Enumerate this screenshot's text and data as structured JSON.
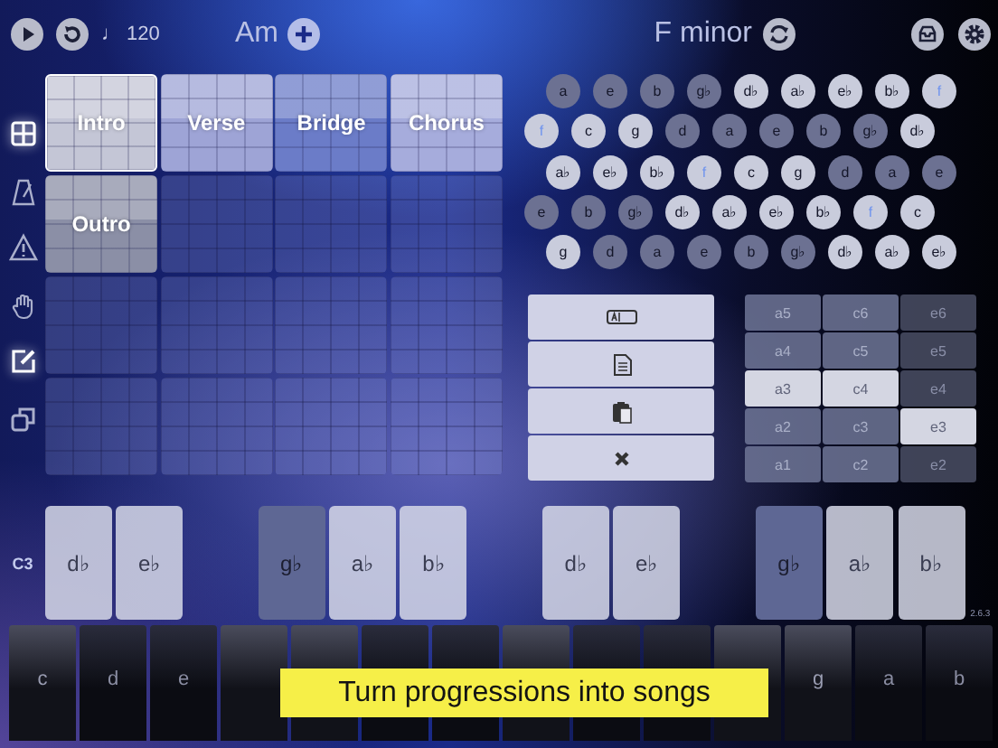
{
  "transport": {
    "tempo": "♩ 120"
  },
  "chord": {
    "name": "Am"
  },
  "key": {
    "name": "F minor"
  },
  "sidebar": {
    "tools": [
      {
        "kind": "grid",
        "active": true
      },
      {
        "kind": "metronome",
        "active": false
      },
      {
        "kind": "warning",
        "active": false
      },
      {
        "kind": "hand",
        "active": false
      },
      {
        "kind": "edit",
        "active": true
      },
      {
        "kind": "copy",
        "active": false
      }
    ]
  },
  "sections": {
    "cells": [
      {
        "kind": "section",
        "label": "Intro",
        "selected": true,
        "color": "#c4c6d6"
      },
      {
        "kind": "section",
        "label": "Verse",
        "selected": false,
        "color": "#9ea4d6"
      },
      {
        "kind": "section",
        "label": "Bridge",
        "selected": false,
        "color": "#6b7cc8"
      },
      {
        "kind": "section",
        "label": "Chorus",
        "selected": false,
        "color": "#a6acdc"
      },
      {
        "kind": "section",
        "label": "Outro",
        "selected": false,
        "color": "#8b8fa6"
      },
      {
        "kind": "empty"
      },
      {
        "kind": "empty"
      },
      {
        "kind": "empty"
      },
      {
        "kind": "empty"
      },
      {
        "kind": "empty"
      },
      {
        "kind": "empty"
      },
      {
        "kind": "empty"
      },
      {
        "kind": "empty"
      },
      {
        "kind": "empty"
      },
      {
        "kind": "empty"
      },
      {
        "kind": "empty"
      }
    ]
  },
  "note_wheel": {
    "rows": [
      [
        {
          "note": "a",
          "in_scale": false,
          "tonic": false
        },
        {
          "note": "e",
          "in_scale": false,
          "tonic": false
        },
        {
          "note": "b",
          "in_scale": false,
          "tonic": false
        },
        {
          "note": "g♭",
          "in_scale": false,
          "tonic": false
        },
        {
          "note": "d♭",
          "in_scale": true,
          "tonic": false
        },
        {
          "note": "a♭",
          "in_scale": true,
          "tonic": false
        },
        {
          "note": "e♭",
          "in_scale": true,
          "tonic": false
        },
        {
          "note": "b♭",
          "in_scale": true,
          "tonic": false
        },
        {
          "note": "f",
          "in_scale": true,
          "tonic": true
        }
      ],
      [
        {
          "note": "f",
          "in_scale": true,
          "tonic": true
        },
        {
          "note": "c",
          "in_scale": true,
          "tonic": false
        },
        {
          "note": "g",
          "in_scale": true,
          "tonic": false
        },
        {
          "note": "d",
          "in_scale": false,
          "tonic": false
        },
        {
          "note": "a",
          "in_scale": false,
          "tonic": false
        },
        {
          "note": "e",
          "in_scale": false,
          "tonic": false
        },
        {
          "note": "b",
          "in_scale": false,
          "tonic": false
        },
        {
          "note": "g♭",
          "in_scale": false,
          "tonic": false
        },
        {
          "note": "d♭",
          "in_scale": true,
          "tonic": false
        }
      ],
      [
        {
          "note": "a♭",
          "in_scale": true,
          "tonic": false
        },
        {
          "note": "e♭",
          "in_scale": true,
          "tonic": false
        },
        {
          "note": "b♭",
          "in_scale": true,
          "tonic": false
        },
        {
          "note": "f",
          "in_scale": true,
          "tonic": true
        },
        {
          "note": "c",
          "in_scale": true,
          "tonic": false
        },
        {
          "note": "g",
          "in_scale": true,
          "tonic": false
        },
        {
          "note": "d",
          "in_scale": false,
          "tonic": false
        },
        {
          "note": "a",
          "in_scale": false,
          "tonic": false
        },
        {
          "note": "e",
          "in_scale": false,
          "tonic": false
        }
      ],
      [
        {
          "note": "e",
          "in_scale": false,
          "tonic": false
        },
        {
          "note": "b",
          "in_scale": false,
          "tonic": false
        },
        {
          "note": "g♭",
          "in_scale": false,
          "tonic": false
        },
        {
          "note": "d♭",
          "in_scale": true,
          "tonic": false
        },
        {
          "note": "a♭",
          "in_scale": true,
          "tonic": false
        },
        {
          "note": "e♭",
          "in_scale": true,
          "tonic": false
        },
        {
          "note": "b♭",
          "in_scale": true,
          "tonic": false
        },
        {
          "note": "f",
          "in_scale": true,
          "tonic": true
        },
        {
          "note": "c",
          "in_scale": true,
          "tonic": false
        }
      ],
      [
        {
          "note": "g",
          "in_scale": true,
          "tonic": false
        },
        {
          "note": "d",
          "in_scale": false,
          "tonic": false
        },
        {
          "note": "a",
          "in_scale": false,
          "tonic": false
        },
        {
          "note": "e",
          "in_scale": false,
          "tonic": false
        },
        {
          "note": "b",
          "in_scale": false,
          "tonic": false
        },
        {
          "note": "g♭",
          "in_scale": false,
          "tonic": false
        },
        {
          "note": "d♭",
          "in_scale": true,
          "tonic": false
        },
        {
          "note": "a♭",
          "in_scale": true,
          "tonic": false
        },
        {
          "note": "e♭",
          "in_scale": true,
          "tonic": false
        }
      ]
    ]
  },
  "actions": [
    {
      "kind": "rename"
    },
    {
      "kind": "copy"
    },
    {
      "kind": "paste"
    },
    {
      "kind": "delete"
    }
  ],
  "voicings": {
    "rows": [
      [
        {
          "label": "a5",
          "selected": false
        },
        {
          "label": "c6",
          "selected": false
        },
        {
          "label": "e6",
          "selected": false
        }
      ],
      [
        {
          "label": "a4",
          "selected": false
        },
        {
          "label": "c5",
          "selected": false
        },
        {
          "label": "e5",
          "selected": false
        }
      ],
      [
        {
          "label": "a3",
          "selected": true
        },
        {
          "label": "c4",
          "selected": true
        },
        {
          "label": "e4",
          "selected": false
        }
      ],
      [
        {
          "label": "a2",
          "selected": false
        },
        {
          "label": "c3",
          "selected": false
        },
        {
          "label": "e3",
          "selected": true
        }
      ],
      [
        {
          "label": "a1",
          "selected": false
        },
        {
          "label": "c2",
          "selected": false
        },
        {
          "label": "e2",
          "selected": false
        }
      ]
    ]
  },
  "chord_keys": {
    "octave": "C3",
    "keys": [
      {
        "kind": "key",
        "label": "d♭",
        "in_scale": true
      },
      {
        "kind": "key",
        "label": "e♭",
        "in_scale": true
      },
      {
        "kind": "gap"
      },
      {
        "kind": "key",
        "label": "g♭",
        "in_scale": false
      },
      {
        "kind": "key",
        "label": "a♭",
        "in_scale": true
      },
      {
        "kind": "key",
        "label": "b♭",
        "in_scale": true
      },
      {
        "kind": "gap"
      },
      {
        "kind": "key",
        "label": "d♭",
        "in_scale": true
      },
      {
        "kind": "key",
        "label": "e♭",
        "in_scale": true
      },
      {
        "kind": "gap"
      },
      {
        "kind": "key",
        "label": "g♭",
        "in_scale": false
      },
      {
        "kind": "key",
        "label": "a♭",
        "in_scale": true
      },
      {
        "kind": "key",
        "label": "b♭",
        "in_scale": true
      }
    ]
  },
  "version": "2.6.3",
  "piano_keys": [
    {
      "label": "c",
      "in_scale": true
    },
    {
      "label": "d",
      "in_scale": false
    },
    {
      "label": "e",
      "in_scale": false
    },
    {
      "in_scale": true
    },
    {
      "in_scale": true
    },
    {
      "in_scale": false
    },
    {
      "in_scale": false
    },
    {
      "in_scale": true
    },
    {
      "in_scale": false
    },
    {
      "in_scale": false
    },
    {
      "in_scale": true
    },
    {
      "label": "g",
      "in_scale": true
    },
    {
      "label": "a",
      "in_scale": false
    },
    {
      "label": "b",
      "in_scale": false
    }
  ],
  "banner": {
    "text": "Turn progressions into songs"
  }
}
